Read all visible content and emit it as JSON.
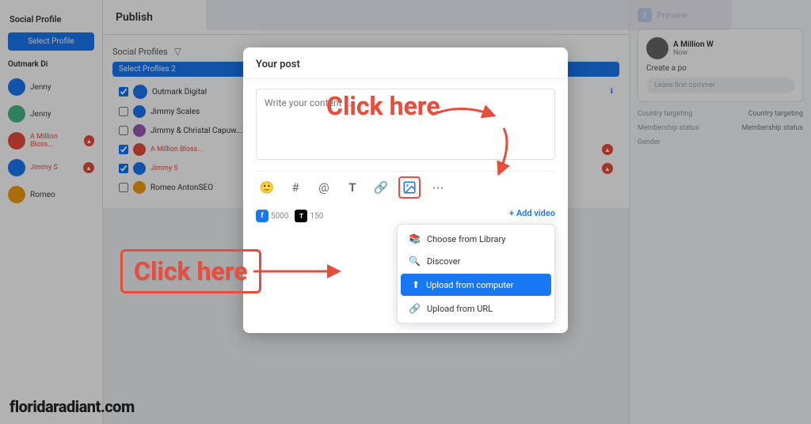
{
  "app": {
    "title": "Social Profiles",
    "bottom_url": "floridaradiant.com"
  },
  "sidebar": {
    "header": "Social Profile",
    "select_profiles": "Select Profile",
    "outmark_label": "Outmark Di",
    "items": [
      {
        "name": "Jenny",
        "color": "blue",
        "badge": ""
      },
      {
        "name": "Jenny",
        "color": "green",
        "badge": ""
      },
      {
        "name": "A Million Bloss...",
        "color": "red",
        "badge": "!"
      },
      {
        "name": "Jenny S",
        "color": "blue",
        "badge": "!"
      },
      {
        "name": "Romeo",
        "color": "orange",
        "badge": ""
      }
    ]
  },
  "publish": {
    "title": "Publish",
    "profiles_label": "Social Profiles",
    "select_btn": "Select Profiles 2",
    "outmark_digital": "Outmark Digital",
    "profile_names": [
      "Jimmy Scales",
      "Jimmy & Christal Capuwo...",
      "A Million Bloss...",
      "Jimmy S",
      "Romeo AntonSEO"
    ]
  },
  "modal": {
    "title": "Your post",
    "textarea_placeholder": "Write your content ...",
    "toolbar_icons": [
      "smile",
      "hash",
      "at",
      "T",
      "link",
      "image",
      "more"
    ],
    "counts": [
      {
        "platform": "FB",
        "count": "5000"
      },
      {
        "platform": "TK",
        "count": "150"
      }
    ],
    "add_video": "+ Add video",
    "dropdown": {
      "items": [
        {
          "icon": "📚",
          "label": "Choose from Library"
        },
        {
          "icon": "🔍",
          "label": "Discover"
        },
        {
          "icon": "⬆",
          "label": "Upload from computer",
          "highlighted": true
        },
        {
          "icon": "🔗",
          "label": "Upload from URL"
        }
      ]
    }
  },
  "annotations": {
    "click_here_top": "Click here",
    "click_here_bottom": "Click here"
  },
  "preview": {
    "label": "Preview",
    "account_name": "A Million W",
    "time": "Now",
    "create_post": "Create a po",
    "leave_comment": "Leave first commer",
    "country_targeting": "Country targeting",
    "membership_status": "Membership status",
    "gender": "Gender"
  }
}
